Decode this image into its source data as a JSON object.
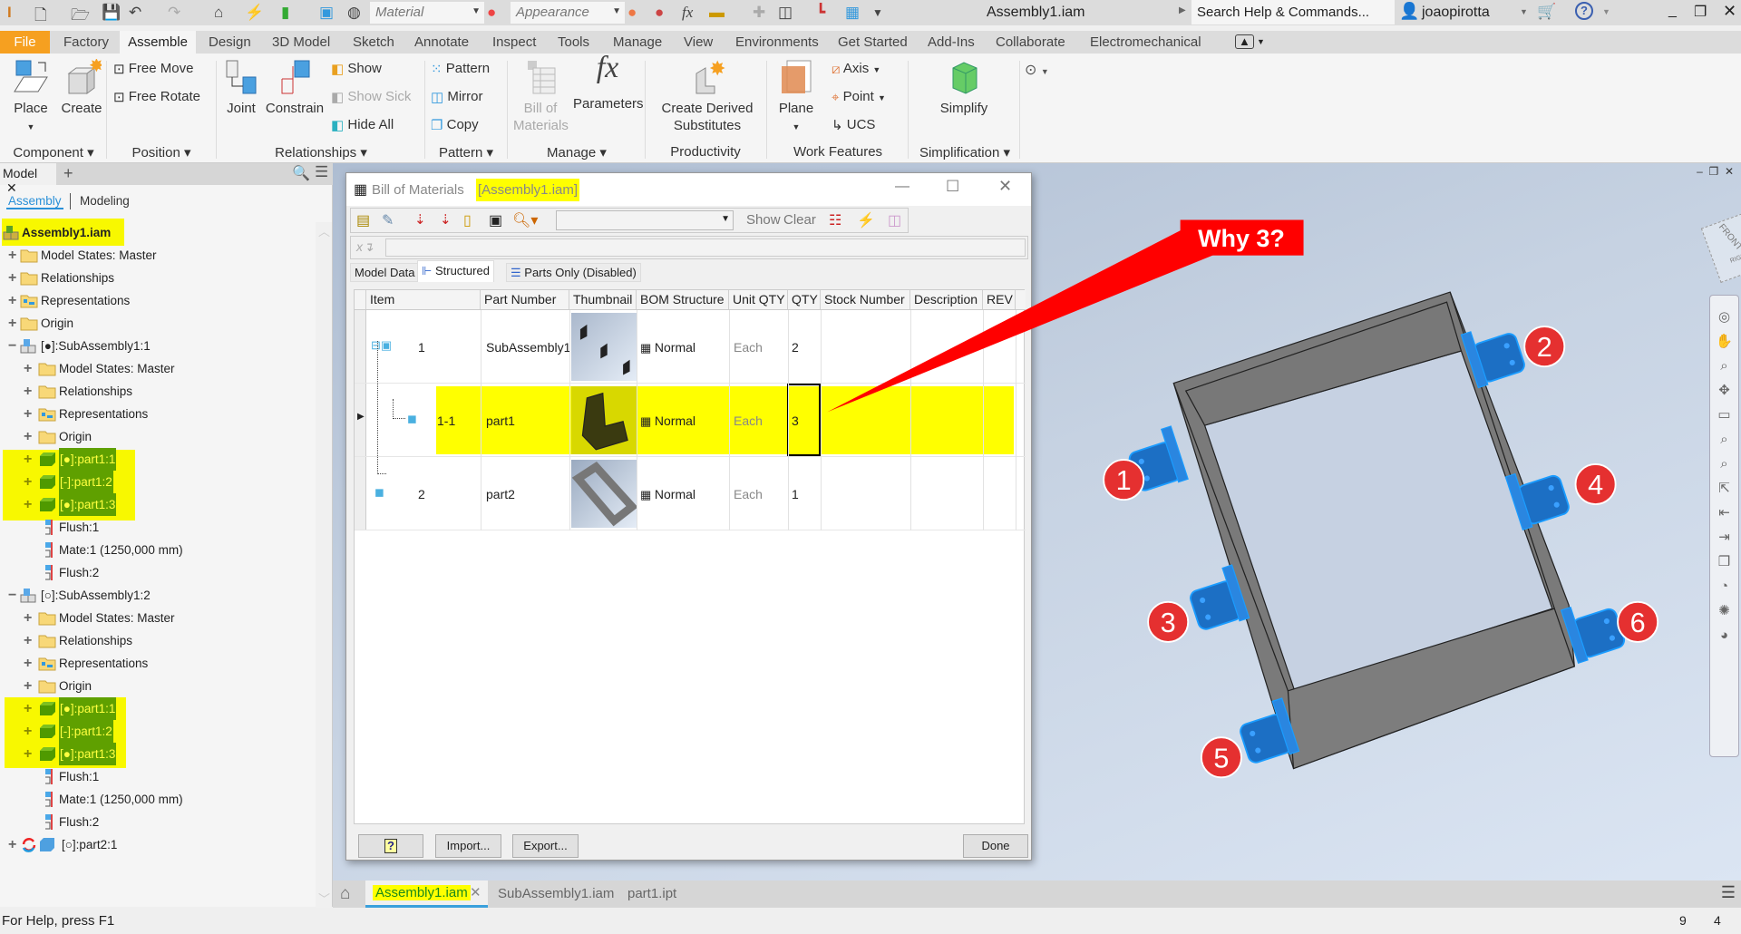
{
  "titlebar": {
    "title": "Assembly1.iam",
    "material": "Material",
    "appearance": "Appearance",
    "search_placeholder": "Search Help & Commands...",
    "user": "joaopirotta"
  },
  "ribbon_tabs": [
    "File",
    "Factory",
    "Assemble",
    "Design",
    "3D Model",
    "Sketch",
    "Annotate",
    "Inspect",
    "Tools",
    "Manage",
    "View",
    "Environments",
    "Get Started",
    "Add-Ins",
    "Collaborate",
    "Electromechanical"
  ],
  "active_tab": "Assemble",
  "ribbon": {
    "place": "Place",
    "create": "Create",
    "free_move": "Free Move",
    "free_rotate": "Free Rotate",
    "joint": "Joint",
    "constrain": "Constrain",
    "show": "Show",
    "show_sick": "Show Sick",
    "hide_all": "Hide All",
    "pattern": "Pattern",
    "mirror": "Mirror",
    "copy": "Copy",
    "bom_1": "Bill of",
    "bom_2": "Materials",
    "parameters": "Parameters",
    "derived_1": "Create Derived",
    "derived_2": "Substitutes",
    "plane": "Plane",
    "axis": "Axis",
    "point": "Point",
    "ucs": "UCS",
    "simplify": "Simplify",
    "groups": [
      "Component",
      "Position",
      "Relationships",
      "Pattern",
      "Manage",
      "Productivity",
      "Work Features",
      "Simplification"
    ]
  },
  "browser": {
    "tab": "Model",
    "subtabs": [
      "Assembly",
      "Modeling"
    ],
    "rows": [
      {
        "label": "Assembly1.iam",
        "depth": -1,
        "exp": "",
        "icon": "assembly",
        "root": true
      },
      {
        "label": "Model States: Master",
        "depth": 0,
        "exp": "+",
        "icon": "folder"
      },
      {
        "label": "Relationships",
        "depth": 0,
        "exp": "+",
        "icon": "folder"
      },
      {
        "label": "Representations",
        "depth": 0,
        "exp": "+",
        "icon": "repfolder"
      },
      {
        "label": "Origin",
        "depth": 0,
        "exp": "+",
        "icon": "folder"
      },
      {
        "label": "[●]:SubAssembly1:1",
        "depth": 0,
        "exp": "−",
        "icon": "subassembly"
      },
      {
        "label": "Model States: Master",
        "depth": 1,
        "exp": "+",
        "icon": "folder"
      },
      {
        "label": "Relationships",
        "depth": 1,
        "exp": "+",
        "icon": "folder"
      },
      {
        "label": "Representations",
        "depth": 1,
        "exp": "+",
        "icon": "repfolder"
      },
      {
        "label": "Origin",
        "depth": 1,
        "exp": "+",
        "icon": "folder"
      },
      {
        "label": "[●]:part1:1",
        "depth": 1,
        "exp": "+",
        "icon": "part",
        "hl": true
      },
      {
        "label": "[-]:part1:2",
        "depth": 1,
        "exp": "+",
        "icon": "part",
        "hl": true
      },
      {
        "label": "[●]:part1:3",
        "depth": 1,
        "exp": "+",
        "icon": "part",
        "hl": true
      },
      {
        "label": "Flush:1",
        "depth": 1,
        "exp": "",
        "icon": "constraint"
      },
      {
        "label": "Mate:1 (1250,000 mm)",
        "depth": 1,
        "exp": "",
        "icon": "constraint"
      },
      {
        "label": "Flush:2",
        "depth": 1,
        "exp": "",
        "icon": "constraint"
      },
      {
        "label": "[○]:SubAssembly1:2",
        "depth": 0,
        "exp": "−",
        "icon": "subassembly"
      },
      {
        "label": "Model States: Master",
        "depth": 1,
        "exp": "+",
        "icon": "folder"
      },
      {
        "label": "Relationships",
        "depth": 1,
        "exp": "+",
        "icon": "folder"
      },
      {
        "label": "Representations",
        "depth": 1,
        "exp": "+",
        "icon": "repfolder"
      },
      {
        "label": "Origin",
        "depth": 1,
        "exp": "+",
        "icon": "folder"
      },
      {
        "label": "[●]:part1:1",
        "depth": 1,
        "exp": "+",
        "icon": "part",
        "hl": true
      },
      {
        "label": "[-]:part1:2",
        "depth": 1,
        "exp": "+",
        "icon": "part",
        "hl": true
      },
      {
        "label": "[●]:part1:3",
        "depth": 1,
        "exp": "+",
        "icon": "part",
        "hl": true
      },
      {
        "label": "Flush:1",
        "depth": 1,
        "exp": "",
        "icon": "constraint"
      },
      {
        "label": "Mate:1 (1250,000 mm)",
        "depth": 1,
        "exp": "",
        "icon": "constraint"
      },
      {
        "label": "Flush:2",
        "depth": 1,
        "exp": "",
        "icon": "constraint"
      },
      {
        "label": "[○]:part2:1",
        "depth": 0,
        "exp": "+",
        "icon": "part2"
      }
    ]
  },
  "bom": {
    "title": "Bill of Materials",
    "title_doc": "[Assembly1.iam]",
    "show": "Show",
    "clear": "Clear",
    "tabs": [
      "Model Data",
      "Structured",
      "Parts Only (Disabled)"
    ],
    "active_tab": "Structured",
    "columns": [
      "Item",
      "Part Number",
      "Thumbnail",
      "BOM Structure",
      "Unit QTY",
      "QTY",
      "Stock Number",
      "Description",
      "REV"
    ],
    "rows": [
      {
        "item": "1",
        "part_number": "SubAssembly1",
        "thumbnail": "brackets",
        "bom_structure": "Normal",
        "unit_qty": "Each",
        "qty": "2",
        "stock_number": "",
        "description": "",
        "rev": ""
      },
      {
        "item": "1-1",
        "part_number": "part1",
        "thumbnail": "bracket",
        "bom_structure": "Normal",
        "unit_qty": "Each",
        "qty": "3",
        "stock_number": "",
        "description": "",
        "rev": "",
        "highlighted": true
      },
      {
        "item": "2",
        "part_number": "part2",
        "thumbnail": "frame",
        "bom_structure": "Normal",
        "unit_qty": "Each",
        "qty": "1",
        "stock_number": "",
        "description": "",
        "rev": ""
      }
    ],
    "buttons": {
      "help": "?",
      "import": "Import...",
      "export": "Export...",
      "done": "Done"
    }
  },
  "annotation": {
    "callout": "Why 3?",
    "balloons": [
      "1",
      "2",
      "3",
      "4",
      "5",
      "6"
    ],
    "color": "#ff0000"
  },
  "viewcube": {
    "front": "FRONT",
    "right": "RIGHT"
  },
  "doc_tabs": [
    "Assembly1.iam",
    "SubAssembly1.iam",
    "part1.ipt"
  ],
  "active_doc": "Assembly1.iam",
  "status": {
    "help": "For Help, press F1",
    "count1": "9",
    "count2": "4"
  },
  "colors": {
    "highlight": "#ffff00",
    "accent": "#f6a020",
    "part_blue": "#1e6fd0",
    "tab_underline": "#3aa0dc"
  }
}
